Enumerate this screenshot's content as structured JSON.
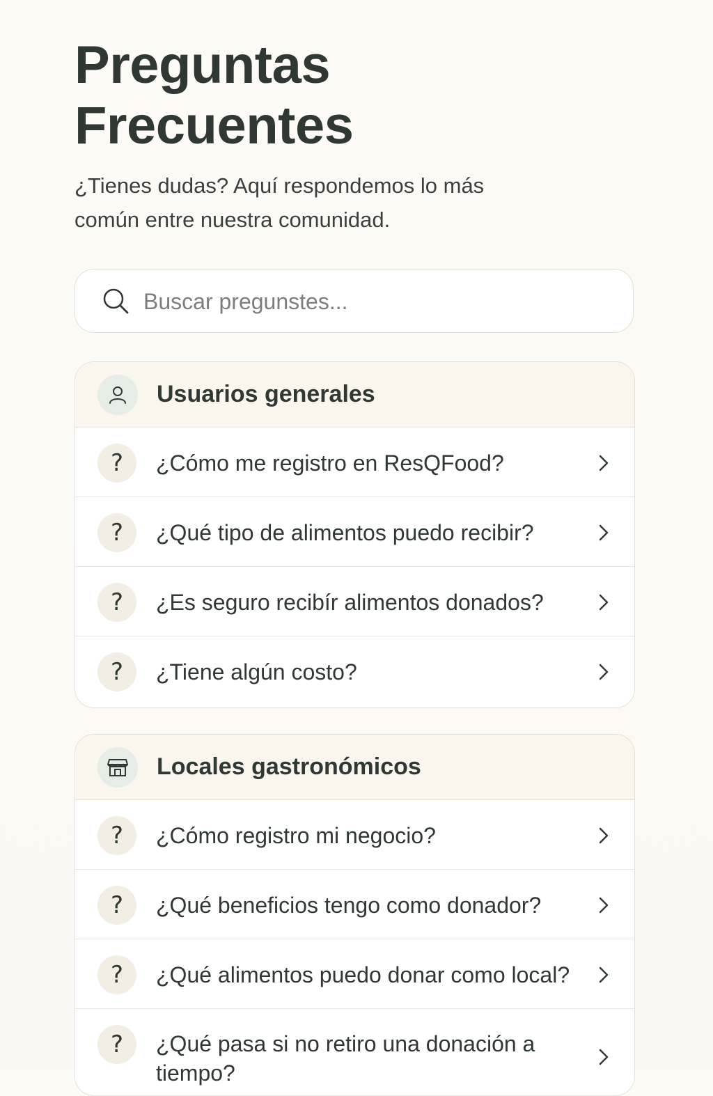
{
  "header": {
    "title": "Preguntas Frecuentes",
    "subtitle": "¿Tienes dudas? Aquí respondemos lo más común entre nuestra comunidad."
  },
  "search": {
    "placeholder": "Buscar pregunstes...",
    "icon": "search-icon"
  },
  "sections": [
    {
      "title": "Usuarios generales",
      "icon": "user-icon",
      "questions": [
        "¿Cómo me registro en ResQFood?",
        "¿Qué tipo de alimentos puedo recibir?",
        "¿Es seguro recibír alimentos donados?",
        "¿Tiene algún costo?"
      ]
    },
    {
      "title": "Locales gastronómicos",
      "icon": "store-icon",
      "questions": [
        "¿Cómo registro mi negocio?",
        "¿Qué beneficios tengo como donador?",
        "¿Qué alimentos puedo donar como local?",
        "¿Qué pasa si no retiro una donación a tiempo?"
      ]
    }
  ],
  "question_glyph": "?",
  "colors": {
    "background": "#fdfbf6",
    "text": "#2f3833",
    "card_header": "#faf6ee",
    "question_badge": "#f3eee3",
    "section_badge": "#e6ece6",
    "border": "#e6e0d6"
  }
}
